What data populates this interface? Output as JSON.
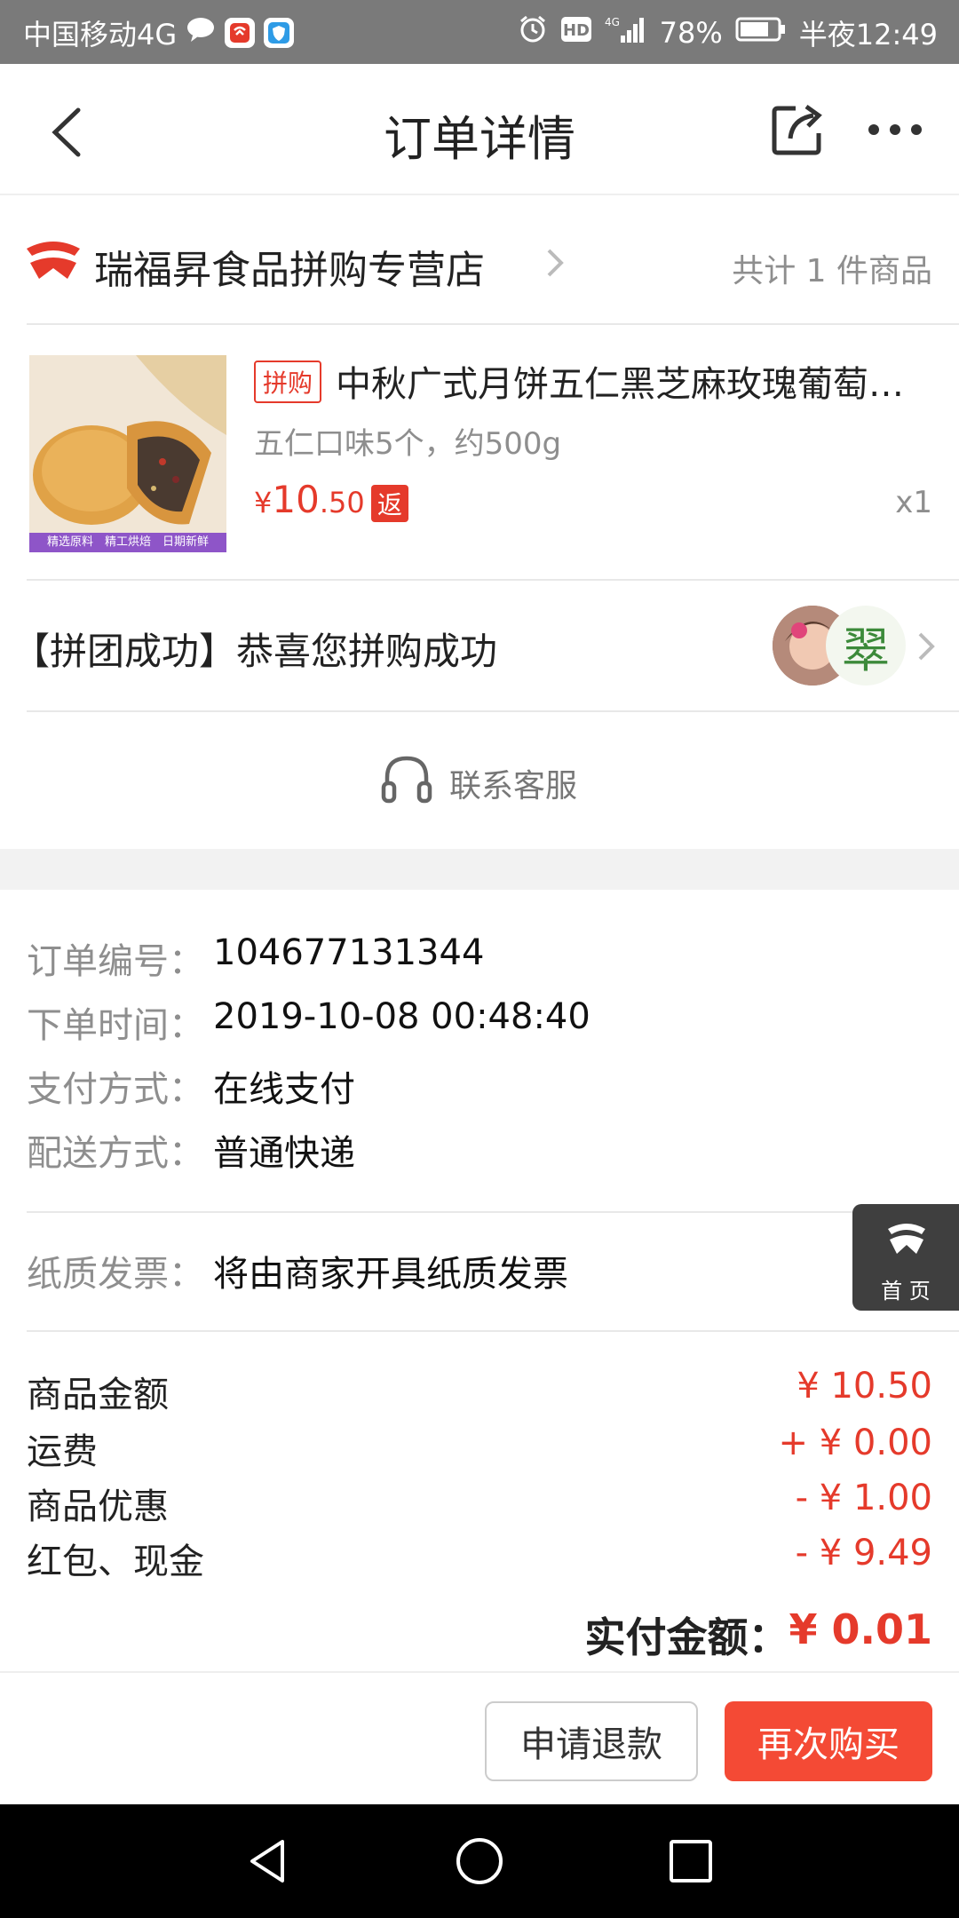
{
  "status_bar": {
    "carrier": "中国移动4G",
    "battery": "78%",
    "time": "半夜12:49"
  },
  "nav": {
    "title": "订单详情"
  },
  "store": {
    "name": "瑞福昇食品拼购专营店",
    "count_text": "共计 1 件商品"
  },
  "product": {
    "tag": "拼购",
    "title": "中秋广式月饼五仁黑芝麻玫瑰葡萄…",
    "spec": "五仁口味5个，约500g",
    "price_symbol": "¥",
    "price_int": "10",
    "price_dec": ".50",
    "rebate_tag": "返",
    "quantity": "x1",
    "image_caption": "精选原料　精工烘焙　日期新鲜"
  },
  "group": {
    "text": "【拼团成功】恭喜您拼购成功",
    "avatar2_char": "翠"
  },
  "service": {
    "label": "联系客服"
  },
  "order": {
    "rows": [
      {
        "label": "订单编号：",
        "value": "104677131344"
      },
      {
        "label": "下单时间：",
        "value": "2019-10-08 00:48:40"
      },
      {
        "label": "支付方式：",
        "value": "在线支付"
      },
      {
        "label": "配送方式：",
        "value": "普通快递"
      }
    ],
    "invoice_label": "纸质发票：",
    "invoice_value": "将由商家开具纸质发票"
  },
  "fees": [
    {
      "label": "商品金额",
      "value": "¥ 10.50"
    },
    {
      "label": "运费",
      "value": "+ ¥ 0.00"
    },
    {
      "label": "商品优惠",
      "value": "- ¥ 1.00"
    },
    {
      "label": "红包、现金",
      "value": "- ¥ 9.49"
    }
  ],
  "total": {
    "label": "实付金额：",
    "value": "¥ 0.01"
  },
  "float_home": {
    "label": "首 页"
  },
  "actions": {
    "refund": "申请退款",
    "rebuy": "再次购买"
  },
  "colors": {
    "accent": "#e53a2b",
    "button_red": "#f44a35",
    "status_bar": "#7a7a7a"
  }
}
